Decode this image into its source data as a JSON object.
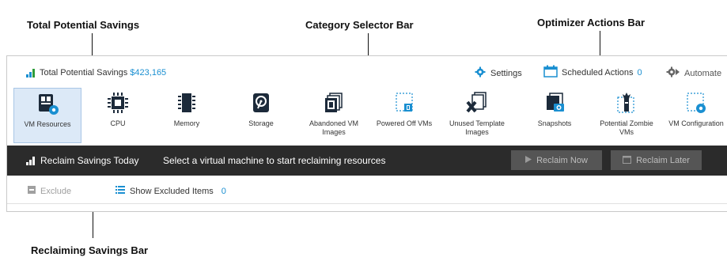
{
  "callouts": {
    "total_savings": "Total Potential Savings",
    "category_selector": "Category Selector Bar",
    "optimizer_actions": "Optimizer Actions Bar",
    "reclaiming_savings": "Reclaiming Savings Bar"
  },
  "topbar": {
    "savings_label": "Total Potential Savings",
    "savings_amount": "$423,165",
    "settings_label": "Settings",
    "scheduled_label": "Scheduled Actions",
    "scheduled_count": "0",
    "automate_label": "Automate"
  },
  "categories": [
    {
      "label": "VM Resources",
      "icon": "vm-resources-icon",
      "selected": true
    },
    {
      "label": "CPU",
      "icon": "cpu-icon"
    },
    {
      "label": "Memory",
      "icon": "memory-icon"
    },
    {
      "label": "Storage",
      "icon": "storage-icon"
    },
    {
      "label": "Abandoned VM Images",
      "icon": "abandoned-images-icon"
    },
    {
      "label": "Powered Off VMs",
      "icon": "powered-off-vms-icon"
    },
    {
      "label": "Unused Template Images",
      "icon": "unused-templates-icon"
    },
    {
      "label": "Snapshots",
      "icon": "snapshots-icon"
    },
    {
      "label": "Potential Zombie VMs",
      "icon": "zombie-vms-icon"
    },
    {
      "label": "VM Configuration",
      "icon": "vm-configuration-icon"
    }
  ],
  "reclaim": {
    "title": "Reclaim Savings Today",
    "message": "Select a virtual machine to start reclaiming resources",
    "reclaim_now": "Reclaim Now",
    "reclaim_later": "Reclaim Later"
  },
  "exclude": {
    "exclude_label": "Exclude",
    "show_excluded_label": "Show Excluded Items",
    "excluded_count": "0"
  },
  "colors": {
    "accent": "#1a8fd1",
    "icon_dark": "#1c2a3a",
    "reclaim_bar": "#2b2b2b"
  }
}
